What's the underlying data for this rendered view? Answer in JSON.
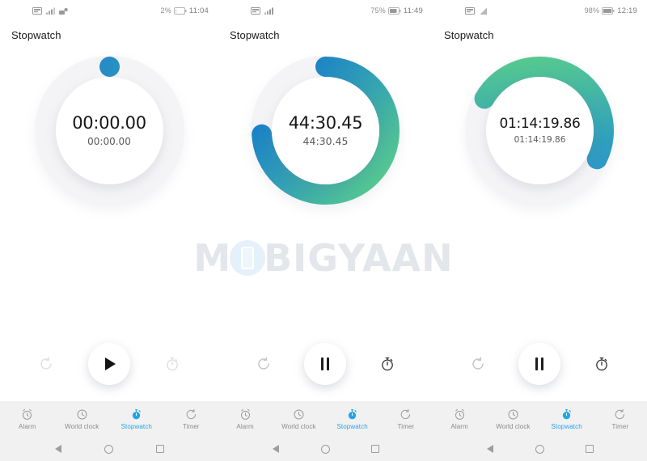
{
  "watermark": {
    "text_before": "M",
    "text_after": "BIGYAAN",
    "full": "MOBIGYAAN"
  },
  "tabbar": {
    "items": [
      {
        "label": "Alarm",
        "icon": "alarm-clock-icon",
        "active": false
      },
      {
        "label": "World clock",
        "icon": "world-clock-icon",
        "active": false
      },
      {
        "label": "Stopwatch",
        "icon": "stopwatch-icon",
        "active": true
      },
      {
        "label": "Timer",
        "icon": "timer-icon",
        "active": false
      }
    ],
    "active_color": "#25a4e8",
    "inactive_color": "#8b8b8b",
    "background": "#f1f1f1"
  },
  "navbar": {
    "back": "back-triangle",
    "home": "home-circle",
    "recents": "recents-square"
  },
  "panels": [
    {
      "id": "panel-1",
      "status": {
        "battery_pct": "2%",
        "time": "11:04",
        "icons": [
          "sim-card-icon",
          "signal-bars-icon",
          "no-network-icon"
        ]
      },
      "title": "Stopwatch",
      "timer": {
        "main": "00:00.00",
        "sub": "00:00.00"
      },
      "progress": {
        "percent": 0,
        "start_color": "#1b7fd4",
        "end_color": "#55c98c"
      },
      "controls": {
        "left": {
          "name": "reset-button",
          "icon": "reset-arrow-icon",
          "enabled": false
        },
        "center": {
          "name": "start-button",
          "icon": "play-icon"
        },
        "right": {
          "name": "lap-button",
          "icon": "lap-stopwatch-icon",
          "enabled": false
        }
      }
    },
    {
      "id": "panel-2",
      "status": {
        "battery_pct": "75%",
        "time": "11:49",
        "icons": [
          "sim-card-icon",
          "signal-bars-icon"
        ]
      },
      "title": "Stopwatch",
      "timer": {
        "main": "44:30.45",
        "sub": "44:30.45"
      },
      "progress": {
        "percent": 74,
        "start_color": "#1b7fd4",
        "end_color": "#55c98c"
      },
      "controls": {
        "left": {
          "name": "reset-button",
          "icon": "reset-arrow-icon",
          "enabled": true
        },
        "center": {
          "name": "pause-button",
          "icon": "pause-icon"
        },
        "right": {
          "name": "lap-button",
          "icon": "lap-stopwatch-icon",
          "enabled": true
        }
      }
    },
    {
      "id": "panel-3",
      "status": {
        "battery_pct": "98%",
        "time": "12:19",
        "icons": [
          "sim-card-icon",
          "signal-bars-icon"
        ]
      },
      "title": "Stopwatch",
      "timer": {
        "main": "01:14:19.86",
        "sub": "01:14:19.86"
      },
      "progress": {
        "percent": 49,
        "start_color": "#1b7fd4",
        "end_color": "#55c98c"
      },
      "controls": {
        "left": {
          "name": "reset-button",
          "icon": "reset-arrow-icon",
          "enabled": true
        },
        "center": {
          "name": "pause-button",
          "icon": "pause-icon"
        },
        "right": {
          "name": "lap-button",
          "icon": "lap-stopwatch-icon",
          "enabled": true
        }
      }
    }
  ]
}
